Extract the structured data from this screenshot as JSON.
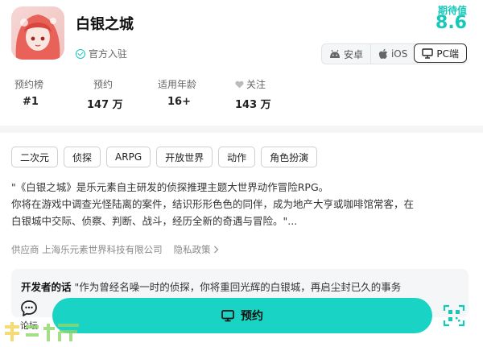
{
  "app": {
    "title": "白银之城",
    "official_label": "官方入驻",
    "rating_label": "期待值",
    "rating_value": "8.6"
  },
  "platforms": [
    {
      "label": "安卓",
      "icon": "android-icon",
      "active": false
    },
    {
      "label": "iOS",
      "icon": "apple-icon",
      "active": false
    },
    {
      "label": "PC端",
      "icon": "monitor-icon",
      "active": true
    }
  ],
  "stats": [
    {
      "label": "预约榜",
      "value": "#1"
    },
    {
      "label": "预约",
      "value": "147 万"
    },
    {
      "label": "适用年龄",
      "value": "16+"
    },
    {
      "label": "关注",
      "value": "143 万",
      "icon": "heart-icon"
    }
  ],
  "tags": [
    "二次元",
    "侦探",
    "ARPG",
    "开放世界",
    "动作",
    "角色扮演"
  ],
  "description": {
    "line1": "\"《白银之城》是乐元素自主研发的侦探推理主题大世界动作冒险RPG。",
    "line2": "你将在游戏中调查光怪陆离的案件，结识形形色色的同伴，成为地产大亨或咖啡馆常客，在",
    "line3": "白银城中交际、侦察、判断、战斗，经历全新的奇遇与冒险。\"..."
  },
  "vendor": {
    "text": "供应商 上海乐元素世界科技有限公司",
    "privacy": "隐私政策"
  },
  "developer_note": {
    "label": "开发者的话",
    "text": "\"作为曾经名噪一时的侦探，你将重回光辉的白银城，再启尘封已久的事务"
  },
  "bottom": {
    "comment_label": "论坛",
    "reserve_label": "预约"
  },
  "colors": {
    "accent": "#19d4c4",
    "rating": "#14c9b8"
  }
}
